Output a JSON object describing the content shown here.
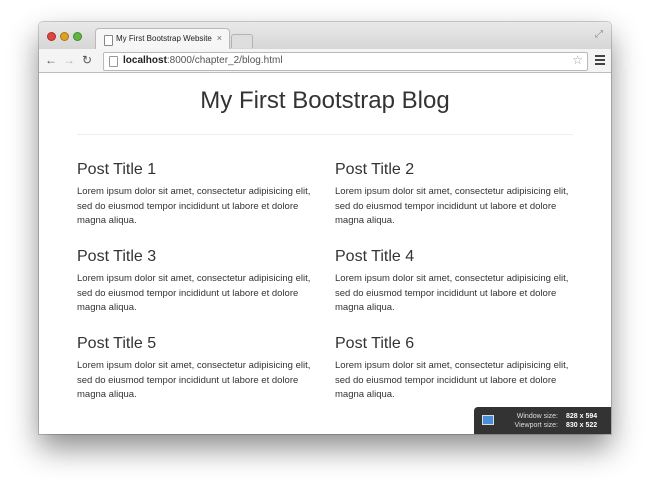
{
  "browser": {
    "tab_title": "My First Bootstrap Website",
    "tab_close": "×",
    "url_host": "localhost",
    "url_rest": ":8000/chapter_2/blog.html"
  },
  "page": {
    "title": "My First Bootstrap Blog",
    "posts": [
      {
        "title": "Post Title 1",
        "body": "Lorem ipsum dolor sit amet, consectetur adipisicing elit, sed do eiusmod tempor incididunt ut labore et dolore magna aliqua."
      },
      {
        "title": "Post Title 2",
        "body": "Lorem ipsum dolor sit amet, consectetur adipisicing elit, sed do eiusmod tempor incididunt ut labore et dolore magna aliqua."
      },
      {
        "title": "Post Title 3",
        "body": "Lorem ipsum dolor sit amet, consectetur adipisicing elit, sed do eiusmod tempor incididunt ut labore et dolore magna aliqua."
      },
      {
        "title": "Post Title 4",
        "body": "Lorem ipsum dolor sit amet, consectetur adipisicing elit, sed do eiusmod tempor incididunt ut labore et dolore magna aliqua."
      },
      {
        "title": "Post Title 5",
        "body": "Lorem ipsum dolor sit amet, consectetur adipisicing elit, sed do eiusmod tempor incididunt ut labore et dolore magna aliqua."
      },
      {
        "title": "Post Title 6",
        "body": "Lorem ipsum dolor sit amet, consectetur adipisicing elit, sed do eiusmod tempor incididunt ut labore et dolore magna aliqua."
      }
    ]
  },
  "viewport_badge": {
    "window_label": "Window size:",
    "window_value": "828 x 594",
    "viewport_label": "Viewport size:",
    "viewport_value": "830 x 522"
  },
  "icons": {
    "close": "traffic-close-icon",
    "minimize": "traffic-minimize-icon",
    "maximize": "traffic-maximize-icon",
    "back": "back-arrow-icon",
    "forward": "forward-arrow-icon",
    "reload": "reload-icon",
    "bookmark": "star-icon",
    "menu": "hamburger-menu-icon"
  }
}
